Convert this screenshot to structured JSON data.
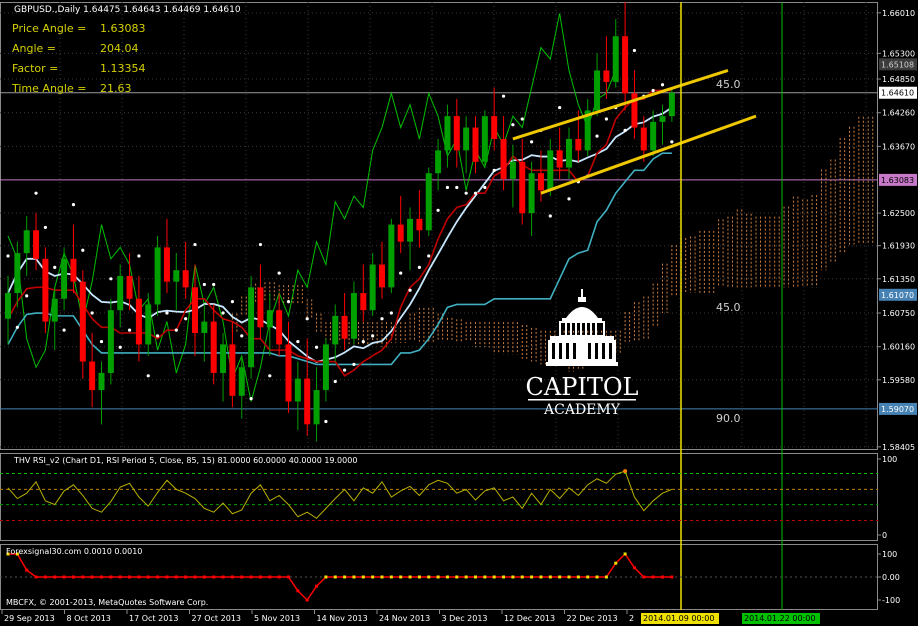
{
  "header": {
    "symbol_line": "GBPUSD.,Daily  1.64475 1.64643 1.64469 1.64610"
  },
  "indicator_info": [
    {
      "label": "Price Angle =",
      "value": "1.63083"
    },
    {
      "label": "Angle =",
      "value": "204.04"
    },
    {
      "label": "Factor =",
      "value": "1.13354"
    },
    {
      "label": "Time Angle =",
      "value": "21.63"
    }
  ],
  "logo": {
    "line1": "CAPITOL",
    "line2": "ACADEMY"
  },
  "angle_labels": {
    "upper": "45.0",
    "middle": "45.0",
    "lower": "90.0"
  },
  "price_axis": {
    "ticks": [
      "1.66010",
      "1.65300",
      "1.64850",
      "1.64260",
      "1.63670",
      "1.62500",
      "1.61930",
      "1.61350",
      "1.60750",
      "1.60160",
      "1.59580",
      "1.58405"
    ],
    "highlights": [
      {
        "text": "1.65108",
        "bg": "#3c3c3c",
        "fg": "#d0d0d0"
      },
      {
        "text": "1.64610",
        "bg": "#ffffff",
        "fg": "#000000"
      },
      {
        "text": "1.63083",
        "bg": "#c878c8",
        "fg": "#000000"
      },
      {
        "text": "1.61070",
        "bg": "#4682b4",
        "fg": "#ffffff"
      },
      {
        "text": "1.59070",
        "bg": "#4682b4",
        "fg": "#ffffff"
      }
    ]
  },
  "rsi_panel": {
    "title": "THV RSI_v2  (Chart D1, RSI Period 5,  Close,  85,  15)  81.0000 60.0000 40.0000 19.0000",
    "ticks": [
      "100",
      "0"
    ]
  },
  "fs_panel": {
    "title": "Forexsignal30.com 0.0010 0.0010",
    "ticks": [
      "100",
      "0.00",
      "-100"
    ],
    "copyright": "MBCFX, © 2001-2013, MetaQuotes Software Corp."
  },
  "time_axis": {
    "labels": [
      "29 Sep 2013",
      "8 Oct 2013",
      "17 Oct 2013",
      "27 Oct 2013",
      "5 Nov 2013",
      "14 Nov 2013",
      "24 Nov 2013",
      "3 Dec 2013",
      "12 Dec 2013",
      "22 Dec 2013",
      "2"
    ],
    "markers": [
      {
        "text": "2014.01.09 00:00",
        "bg": "#f0e000",
        "fg": "#000000"
      },
      {
        "text": "2014.01.22 00:00",
        "bg": "#00c000",
        "fg": "#000000"
      }
    ]
  },
  "colors": {
    "bull": "#00a000",
    "bear": "#ff0000",
    "kijun": "#c00000",
    "tenkan": "#c8e8ff",
    "teal": "#40b0c0",
    "chikou": "#00c000",
    "cloud": "#d08040",
    "parabolic": "#ffffff",
    "channel": "#f0c800",
    "rsi": "#b8b000",
    "grid": "#3a3a3a"
  },
  "chart_data": {
    "type": "candlestick",
    "symbol": "GBPUSD.",
    "timeframe": "Daily",
    "ylim": [
      1.5835,
      1.662
    ],
    "last_close": 1.6461,
    "ohlc": [
      [
        1.6065,
        1.614,
        1.602,
        1.611
      ],
      [
        1.611,
        1.62,
        1.6085,
        1.618
      ],
      [
        1.618,
        1.6245,
        1.614,
        1.622
      ],
      [
        1.622,
        1.625,
        1.615,
        1.617
      ],
      [
        1.617,
        1.619,
        1.604,
        1.606
      ],
      [
        1.606,
        1.612,
        1.601,
        1.61
      ],
      [
        1.61,
        1.619,
        1.608,
        1.617
      ],
      [
        1.617,
        1.623,
        1.611,
        1.613
      ],
      [
        1.613,
        1.615,
        1.596,
        1.599
      ],
      [
        1.599,
        1.604,
        1.591,
        1.594
      ],
      [
        1.594,
        1.599,
        1.588,
        1.597
      ],
      [
        1.597,
        1.61,
        1.595,
        1.608
      ],
      [
        1.608,
        1.616,
        1.605,
        1.614
      ],
      [
        1.614,
        1.618,
        1.608,
        1.61
      ],
      [
        1.61,
        1.614,
        1.599,
        1.602
      ],
      [
        1.602,
        1.611,
        1.6,
        1.609
      ],
      [
        1.609,
        1.621,
        1.607,
        1.619
      ],
      [
        1.619,
        1.624,
        1.611,
        1.613
      ],
      [
        1.613,
        1.618,
        1.608,
        1.615
      ],
      [
        1.615,
        1.62,
        1.61,
        1.612
      ],
      [
        1.612,
        1.616,
        1.6,
        1.604
      ],
      [
        1.604,
        1.609,
        1.599,
        1.606
      ],
      [
        1.606,
        1.609,
        1.595,
        1.597
      ],
      [
        1.597,
        1.604,
        1.592,
        1.602
      ],
      [
        1.602,
        1.606,
        1.591,
        1.593
      ],
      [
        1.593,
        1.6,
        1.589,
        1.598
      ],
      [
        1.598,
        1.614,
        1.596,
        1.612
      ],
      [
        1.612,
        1.616,
        1.603,
        1.605
      ],
      [
        1.605,
        1.611,
        1.6,
        1.608
      ],
      [
        1.608,
        1.611,
        1.6,
        1.602
      ],
      [
        1.602,
        1.606,
        1.59,
        1.592
      ],
      [
        1.592,
        1.599,
        1.587,
        1.596
      ],
      [
        1.596,
        1.603,
        1.586,
        1.588
      ],
      [
        1.588,
        1.598,
        1.585,
        1.594
      ],
      [
        1.594,
        1.603,
        1.592,
        1.602
      ],
      [
        1.602,
        1.609,
        1.599,
        1.607
      ],
      [
        1.607,
        1.611,
        1.601,
        1.603
      ],
      [
        1.603,
        1.613,
        1.602,
        1.611
      ],
      [
        1.611,
        1.616,
        1.606,
        1.608
      ],
      [
        1.608,
        1.618,
        1.607,
        1.616
      ],
      [
        1.616,
        1.62,
        1.61,
        1.612
      ],
      [
        1.612,
        1.624,
        1.611,
        1.623
      ],
      [
        1.623,
        1.628,
        1.618,
        1.62
      ],
      [
        1.62,
        1.626,
        1.615,
        1.624
      ],
      [
        1.624,
        1.629,
        1.619,
        1.622
      ],
      [
        1.622,
        1.633,
        1.621,
        1.632
      ],
      [
        1.632,
        1.638,
        1.629,
        1.636
      ],
      [
        1.636,
        1.644,
        1.633,
        1.642
      ],
      [
        1.642,
        1.645,
        1.633,
        1.636
      ],
      [
        1.636,
        1.642,
        1.632,
        1.64
      ],
      [
        1.64,
        1.642,
        1.632,
        1.634
      ],
      [
        1.634,
        1.643,
        1.633,
        1.642
      ],
      [
        1.642,
        1.647,
        1.636,
        1.638
      ],
      [
        1.638,
        1.642,
        1.629,
        1.631
      ],
      [
        1.631,
        1.637,
        1.626,
        1.634
      ],
      [
        1.634,
        1.638,
        1.623,
        1.625
      ],
      [
        1.625,
        1.634,
        1.621,
        1.632
      ],
      [
        1.632,
        1.636,
        1.627,
        1.629
      ],
      [
        1.629,
        1.638,
        1.628,
        1.636
      ],
      [
        1.636,
        1.64,
        1.631,
        1.633
      ],
      [
        1.633,
        1.64,
        1.631,
        1.638
      ],
      [
        1.638,
        1.643,
        1.634,
        1.636
      ],
      [
        1.636,
        1.645,
        1.635,
        1.643
      ],
      [
        1.643,
        1.653,
        1.642,
        1.65
      ],
      [
        1.65,
        1.656,
        1.645,
        1.648
      ],
      [
        1.648,
        1.659,
        1.647,
        1.656
      ],
      [
        1.656,
        1.662,
        1.643,
        1.646
      ],
      [
        1.646,
        1.65,
        1.638,
        1.64
      ],
      [
        1.64,
        1.642,
        1.634,
        1.636
      ],
      [
        1.636,
        1.643,
        1.635,
        1.641
      ],
      [
        1.641,
        1.644,
        1.637,
        1.642
      ],
      [
        1.642,
        1.647,
        1.641,
        1.6461
      ]
    ],
    "rsi": {
      "levels": [
        81,
        60,
        40,
        19
      ],
      "values": [
        62,
        48,
        55,
        70,
        45,
        40,
        58,
        66,
        52,
        35,
        30,
        44,
        63,
        68,
        50,
        38,
        56,
        72,
        60,
        55,
        48,
        35,
        30,
        42,
        28,
        33,
        55,
        66,
        45,
        52,
        40,
        24,
        30,
        22,
        35,
        48,
        60,
        45,
        62,
        55,
        70,
        50,
        58,
        64,
        52,
        66,
        72,
        68,
        55,
        60,
        46,
        58,
        62,
        45,
        50,
        35,
        55,
        40,
        60,
        48,
        62,
        52,
        66,
        74,
        68,
        80,
        84,
        50,
        32,
        45,
        55,
        60
      ]
    },
    "fs_signal": {
      "values": [
        100,
        100,
        30,
        0,
        0,
        0,
        0,
        0,
        0,
        0,
        0,
        0,
        0,
        0,
        0,
        0,
        0,
        0,
        0,
        0,
        0,
        0,
        0,
        0,
        0,
        0,
        0,
        0,
        0,
        0,
        0,
        -60,
        -100,
        -40,
        0,
        0,
        0,
        0,
        0,
        0,
        0,
        0,
        0,
        0,
        0,
        0,
        0,
        0,
        0,
        0,
        0,
        0,
        0,
        0,
        0,
        0,
        0,
        0,
        0,
        0,
        0,
        0,
        0,
        0,
        0,
        60,
        100,
        40,
        0,
        0,
        0,
        0
      ]
    }
  }
}
